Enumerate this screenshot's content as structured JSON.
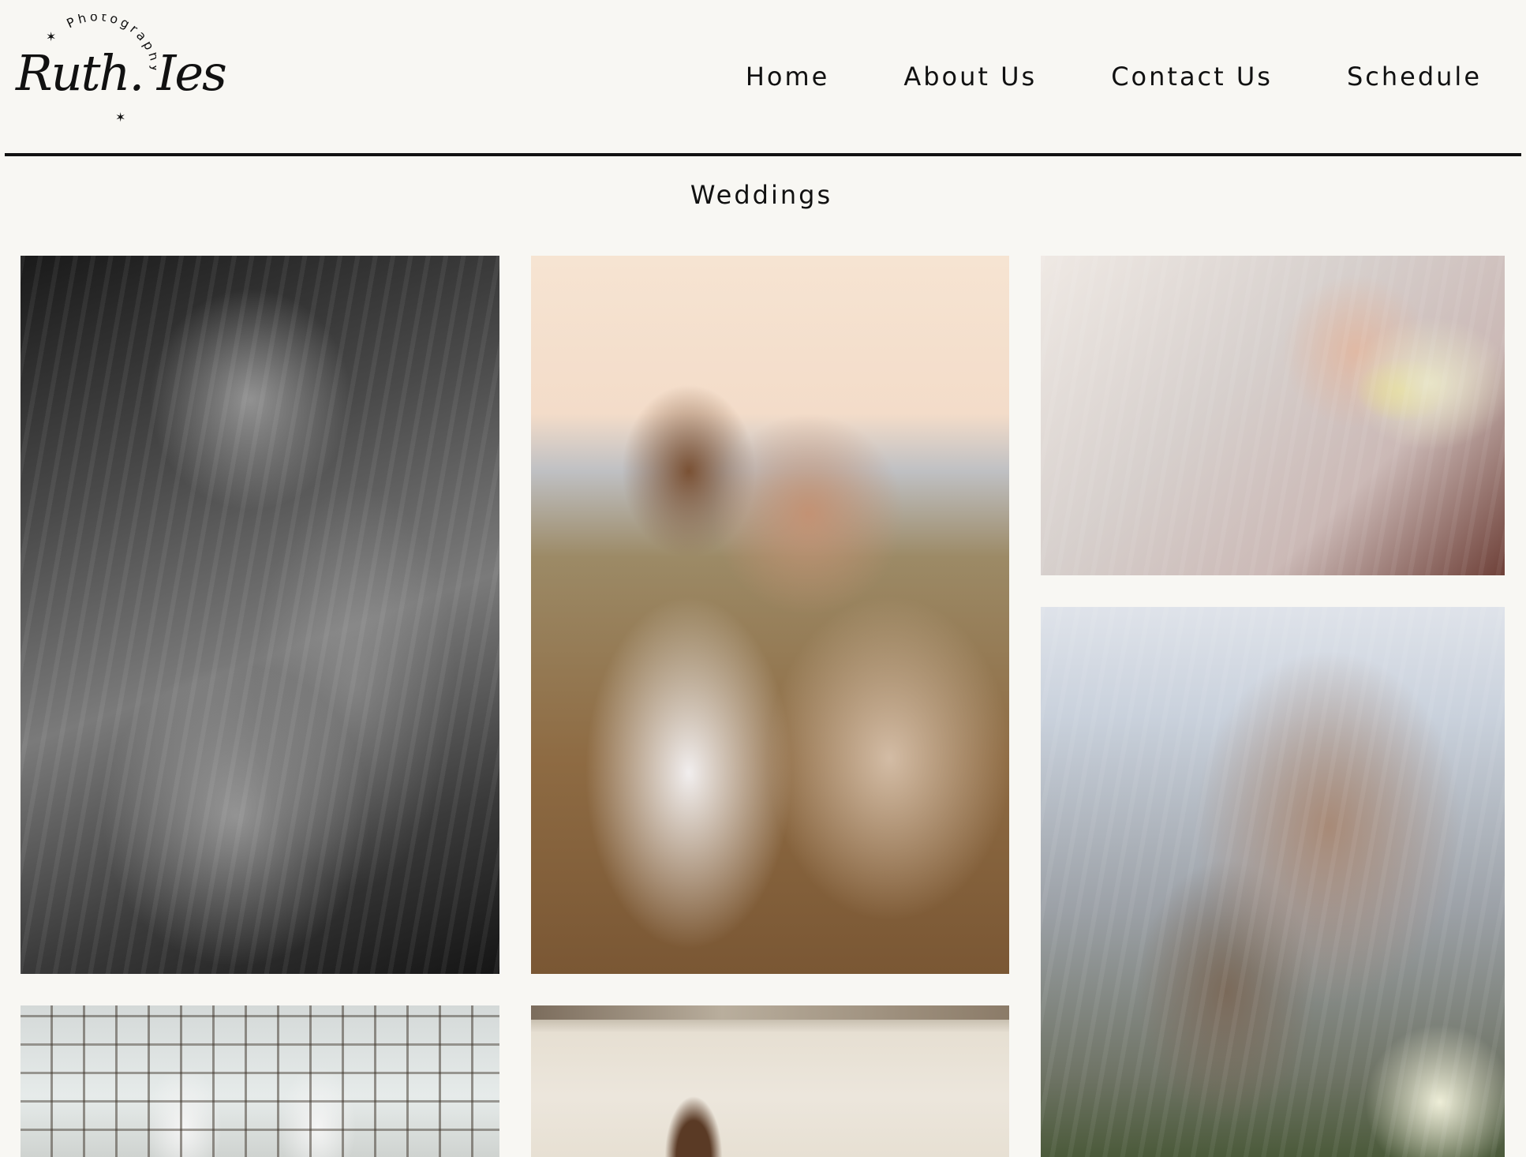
{
  "brand": {
    "logo_script": "Ruth. Ies",
    "logo_arc_text": "Photography"
  },
  "nav": {
    "items": [
      {
        "label": "Home"
      },
      {
        "label": "About Us"
      },
      {
        "label": "Contact Us"
      },
      {
        "label": "Schedule"
      }
    ]
  },
  "section": {
    "title": "Weddings"
  }
}
